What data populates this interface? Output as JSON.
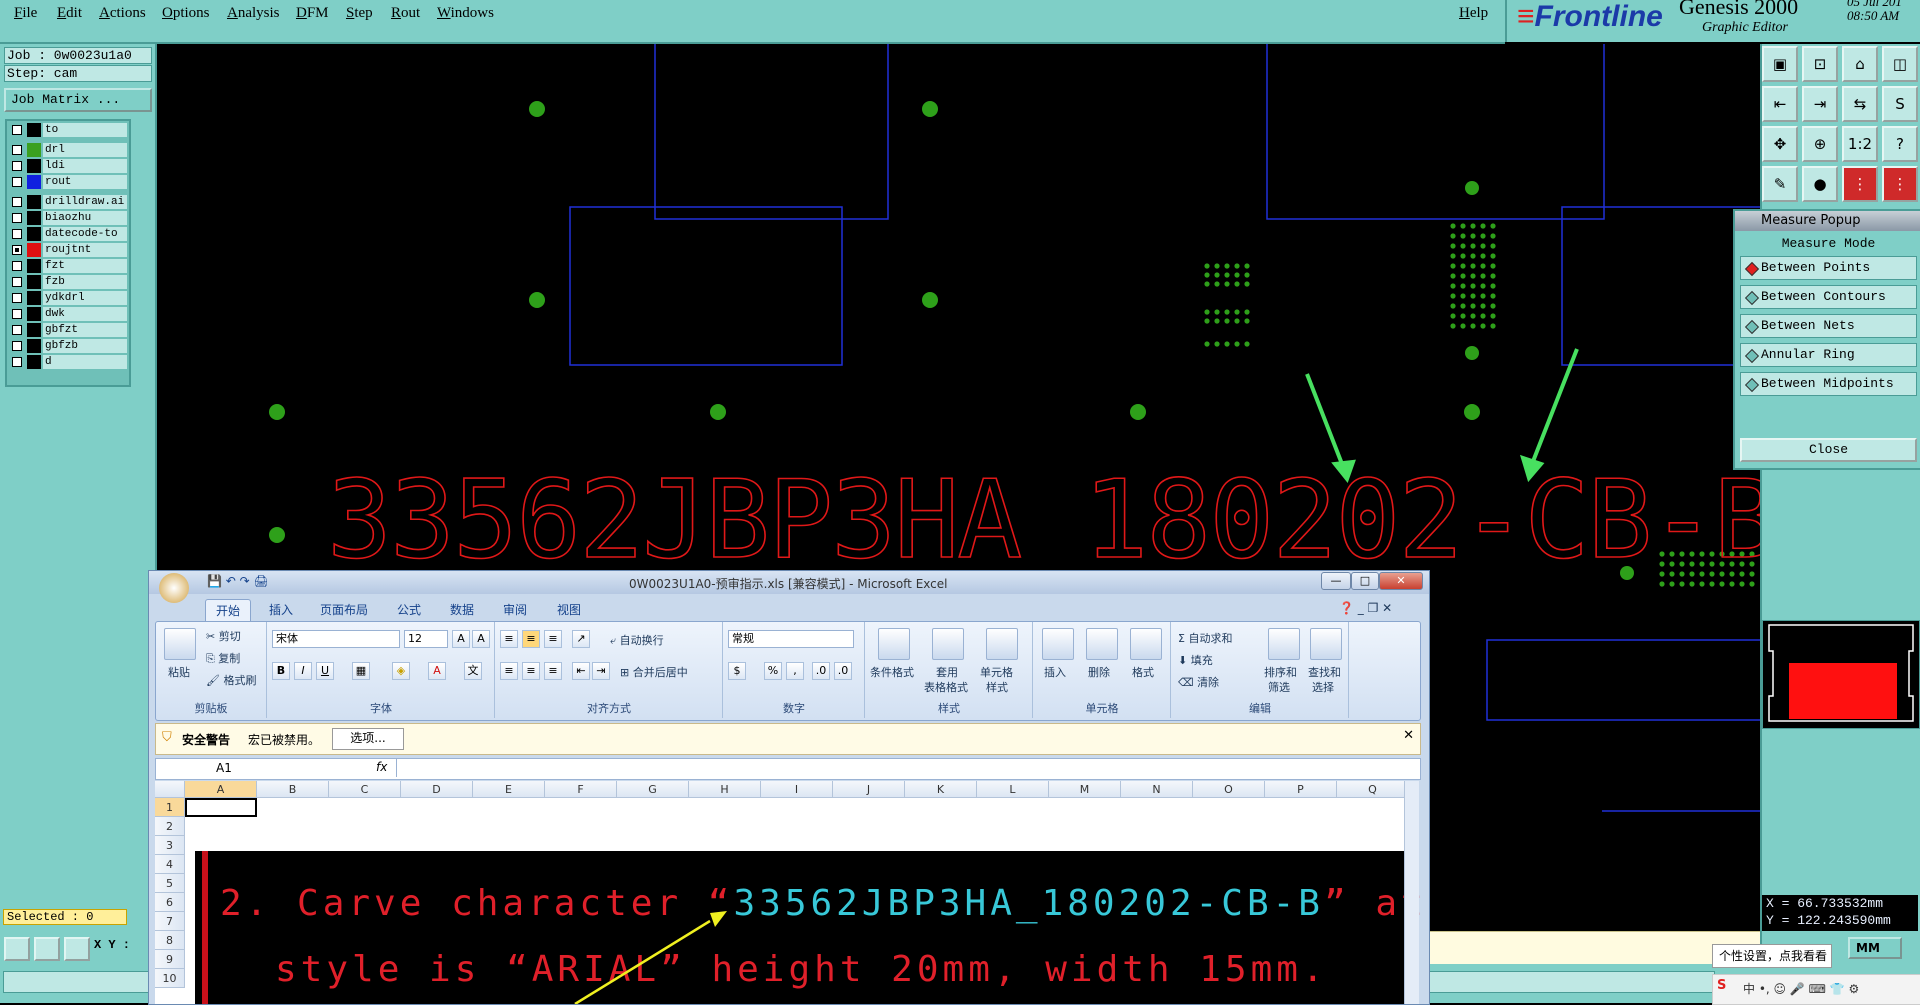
{
  "menu": {
    "items": [
      "File",
      "Edit",
      "Actions",
      "Options",
      "Analysis",
      "DFM",
      "Step",
      "Rout",
      "Windows"
    ],
    "help": "Help"
  },
  "brand": {
    "logo": "Frontline",
    "product": "Genesis 2000",
    "subtitle": "Graphic Editor",
    "date": "05 Jul 201",
    "time": "08:50 AM"
  },
  "left_panel": {
    "job": "Job : 0w0023u1a0",
    "step": "Step: cam",
    "job_matrix": "Job Matrix ...",
    "layers": [
      {
        "name": "to",
        "color": "#000000",
        "checked": false
      },
      {
        "name": "drl",
        "color": "#3aa020",
        "checked": false
      },
      {
        "name": "ldi",
        "color": "#000000",
        "checked": false
      },
      {
        "name": "rout",
        "color": "#1020e0",
        "checked": false
      },
      {
        "name": "drilldraw.ai",
        "color": "#000000",
        "checked": false
      },
      {
        "name": "biaozhu",
        "color": "#000000",
        "checked": false
      },
      {
        "name": "datecode-to",
        "color": "#000000",
        "checked": false
      },
      {
        "name": "roujtnt",
        "color": "#e01010",
        "checked": true
      },
      {
        "name": "fzt",
        "color": "#000000",
        "checked": false
      },
      {
        "name": "fzb",
        "color": "#000000",
        "checked": false
      },
      {
        "name": "ydkdrl",
        "color": "#000000",
        "checked": false
      },
      {
        "name": "dwk",
        "color": "#000000",
        "checked": false
      },
      {
        "name": "gbfzt",
        "color": "#000000",
        "checked": false
      },
      {
        "name": "gbfzb",
        "color": "#000000",
        "checked": false
      },
      {
        "name": "d",
        "color": "#000000",
        "checked": false
      }
    ],
    "selected": "Selected : 0",
    "xy_label": "X Y :"
  },
  "canvas": {
    "board_text": "33562JBP3HA_180202-CB-B"
  },
  "measure_popup": {
    "title": "Measure Popup",
    "mode_label": "Measure Mode",
    "options": [
      "Between Points",
      "Between Contours",
      "Between Nets",
      "Annular Ring",
      "Between Midpoints"
    ],
    "selected_option": "Between Points",
    "close": "Close"
  },
  "toolbar": {
    "icons": [
      "window-icon",
      "window-down-icon",
      "home-icon",
      "split-icon",
      "arrow-left-icon",
      "arrow-right-icon",
      "swap-icon",
      "s-curve-icon",
      "fit-icon",
      "center-icon",
      "ratio-icon",
      "help-icon",
      "pen-icon",
      "probe-icon",
      "layers-red-icon",
      "layers-red2-icon"
    ],
    "ratio_label": "1:2",
    "help_label": "?"
  },
  "coords": {
    "x": "X = 66.733532mm",
    "y": "Y = 122.243590mm"
  },
  "units": "MM",
  "ime_tooltip": "个性设置，点我看看",
  "excel": {
    "title": "0W0023U1A0-预审指示.xls [兼容模式] - Microsoft Excel",
    "tabs": [
      "开始",
      "插入",
      "页面布局",
      "公式",
      "数据",
      "审阅",
      "视图"
    ],
    "clipboard": {
      "paste": "粘贴",
      "cut": "剪切",
      "copy": "复制",
      "painter": "格式刷",
      "label": "剪贴板"
    },
    "font": {
      "name": "宋体",
      "size": "12",
      "label": "字体"
    },
    "alignment": {
      "wrap": "自动换行",
      "merge": "合并后居中",
      "label": "对齐方式"
    },
    "number": {
      "format": "常规",
      "label": "数字"
    },
    "styles": {
      "cond": "条件格式",
      "table_l1": "套用",
      "table_l2": "表格格式",
      "cell_l1": "单元格",
      "cell_l2": "样式",
      "label": "样式"
    },
    "cells": {
      "insert": "插入",
      "delete": "删除",
      "format": "格式",
      "label": "单元格"
    },
    "editing": {
      "autosum": "自动求和",
      "fill": "填充",
      "clear": "清除",
      "sort_l1": "排序和",
      "sort_l2": "筛选",
      "find_l1": "查找和",
      "find_l2": "选择",
      "label": "编辑"
    },
    "security": {
      "title": "安全警告",
      "message": "宏已被禁用。",
      "button": "选项..."
    },
    "name_box": "A1",
    "fx": "fx",
    "columns": [
      "A",
      "B",
      "C",
      "D",
      "E",
      "F",
      "G",
      "H",
      "I",
      "J",
      "K",
      "L",
      "M",
      "N",
      "O",
      "P",
      "Q"
    ],
    "rows": [
      "1",
      "2",
      "3",
      "4",
      "5",
      "6",
      "7",
      "8",
      "9",
      "10"
    ],
    "embedded_line1_a": "2. Carve character “",
    "embedded_line1_code": "33562JBP3HA_180202-CB-B",
    "embedded_line1_b": "” at one c",
    "embedded_line2": "style is “ARIAL” height 20mm, width 15mm."
  }
}
